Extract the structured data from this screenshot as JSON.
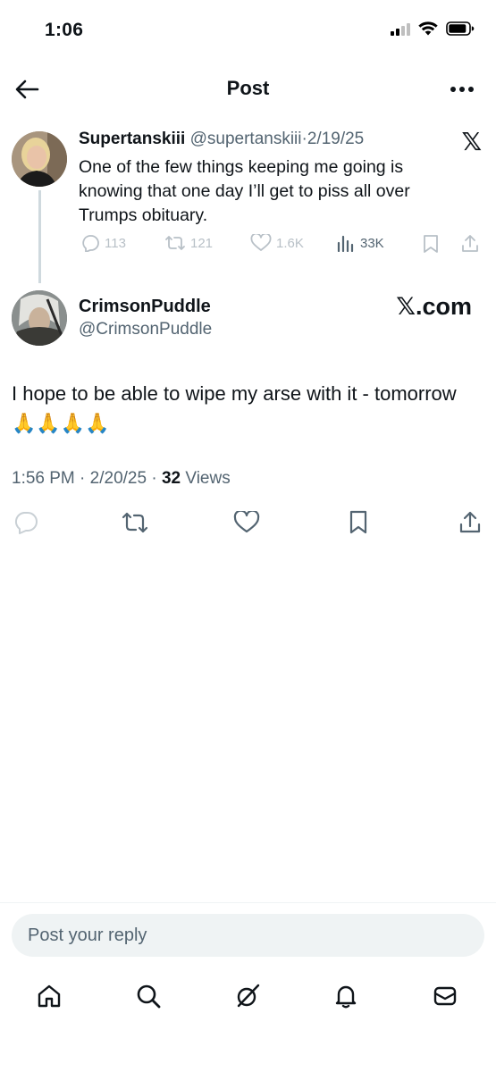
{
  "status_bar": {
    "time": "1:06"
  },
  "header": {
    "title": "Post"
  },
  "quoted_post": {
    "name": "Supertanskiii",
    "handle": "@supertanskiii",
    "date": "2/19/25",
    "text": "One of the few things keeping me going is knowing that one day I’ll get to piss all over Trumps obituary.",
    "replies": "113",
    "reposts": "121",
    "likes": "1.6K",
    "views": "33K"
  },
  "post": {
    "name": "CrimsonPuddle",
    "handle": "@CrimsonPuddle",
    "watermark_x": "𝕏",
    "watermark_domain": ".com",
    "text": "I hope to be able to wipe my arse with it - tomorrow",
    "emoji": "🙏🙏🙏🙏",
    "time": "1:56 PM",
    "date": "2/20/25",
    "views_count": "32",
    "views_label": "Views",
    "separator": "·"
  },
  "composer": {
    "placeholder": "Post your reply"
  },
  "icons": {
    "x_logo": "𝕏",
    "nav": [
      "home-icon",
      "search-icon",
      "grok-icon",
      "notifications-icon",
      "messages-icon"
    ]
  }
}
